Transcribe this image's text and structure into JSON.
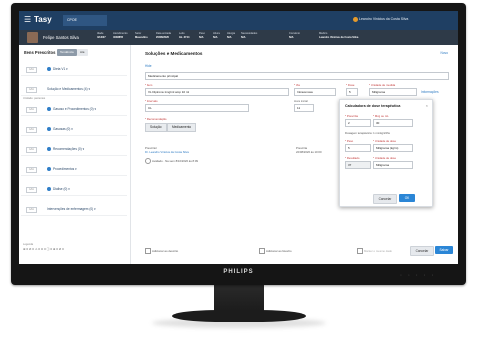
{
  "app": {
    "title": "Tasy",
    "tab_label": "CPOE",
    "user": "Leandro Vinicius da Costa Silva"
  },
  "patient": {
    "name": "Felipe Santos Silva",
    "fields": [
      {
        "label": "Idade",
        "value": "4/13/27"
      },
      {
        "label": "Atendimento",
        "value": "4038855"
      },
      {
        "label": "Setor",
        "value": "Mascullno"
      },
      {
        "label": "Data entrada",
        "value": "20/08/2020"
      },
      {
        "label": "Leito",
        "value": "Int. 3744"
      },
      {
        "label": "Peso",
        "value": "N/A"
      },
      {
        "label": "Altura",
        "value": "N/A"
      },
      {
        "label": "Alergia",
        "value": "N/A"
      },
      {
        "label": "Necessidades",
        "value": "N/A"
      },
      {
        "label": "Convênio",
        "value": "N/A"
      },
      {
        "label": "Médico",
        "value": "Leandro Vinicius da Costa Silva"
      }
    ]
  },
  "left": {
    "title": "Itens Prescritos",
    "pill_a": "Tendência",
    "pill_b": "Até",
    "rows": [
      {
        "box": "1/11",
        "text": "Dieta V1 ▾"
      },
      {
        "box": "1/11",
        "text": "Solução e Medicamentos (4) ▾"
      },
      {
        "box": "1/11",
        "text": "Gasoso e Procedimentos (0) ▾"
      },
      {
        "box": "1/11",
        "text": "Gasosas (0) ▾"
      },
      {
        "box": "1/11",
        "text": "Recomendações (0) ▾"
      },
      {
        "box": "1/11",
        "text": "Procedimentos ▾"
      },
      {
        "box": "1/11",
        "text": "Dialise (0) ▾"
      },
      {
        "box": "1/11",
        "text": "Intervenções de enfermagem (0) ▾"
      }
    ],
    "sub_note": "Unidade: pacientes",
    "bottom_label": "Legenda",
    "bottom": "⊕ 0  ⊘ 0  ⚠ 0  ⊙ 0  ⓘ 0  ⊕ 0  ⊘ 0"
  },
  "main": {
    "title": "Soluções e Medicamentos",
    "link_right": "Novo",
    "link_top": "Hide",
    "select1": "Medicamento principal",
    "f_item_label": "* Item",
    "f_item_value": "VL Dipirona 1mg/ml amp 10 ml",
    "f_via_label": "* Via",
    "f_via_value": "Intravenosa",
    "f_dose_label": "* Dose",
    "f_dose_value": "5",
    "f_unit_label": "* Unidade de medida",
    "f_unit_value": "Miligrama",
    "f_link2": "Informações",
    "f_interval_label": "* Intervalo",
    "f_interval_value": "CL",
    "f_hour_label": "Hora inicial",
    "f_hour_value": "11",
    "f_rec_label": "* Recomendação",
    "chip1": "Solução",
    "chip2": "Medicamento",
    "presc_label": "Prescritor",
    "presc_value": "Dr. Leandro Vinicius da Costa Silva",
    "presc_r_label": "Prescrita",
    "presc_r_value": "22/08/2020 às 10:00",
    "status": "Avaliado · Na sem 8/10/2020 às 8:09",
    "bottom_check1": "Adicionar ao descrito",
    "bottom_check2": "Adicionar ao favorito",
    "bottom_check3": "Manter o mesmo dado",
    "btn_cancel": "Cancelar",
    "btn_save": "Salvar"
  },
  "dialog": {
    "title": "Calculadora de dose terapêutica",
    "c1_label": "* Prescrita",
    "c1_value": "2",
    "c2_label": "* Mcg ou mL",
    "c2_value": "30",
    "note": "Dosagem terapêutica: 1 mL/kg/24hs",
    "d1_label": "* Peso",
    "d1_value": "5",
    "d2_label": "* Unidade de dose",
    "d2_value": "Miligrama (kg/m)",
    "e1_label": "* Resultado",
    "e1_value": "37",
    "e2_label": "* Unidade de dose",
    "e2_value": "Miligrama",
    "btn_cancel": "Cancelar",
    "btn_ok": "OK"
  },
  "monitor": {
    "brand": "PHILIPS",
    "buttons": "▫ ▫ ▫ ▫ ▫"
  }
}
